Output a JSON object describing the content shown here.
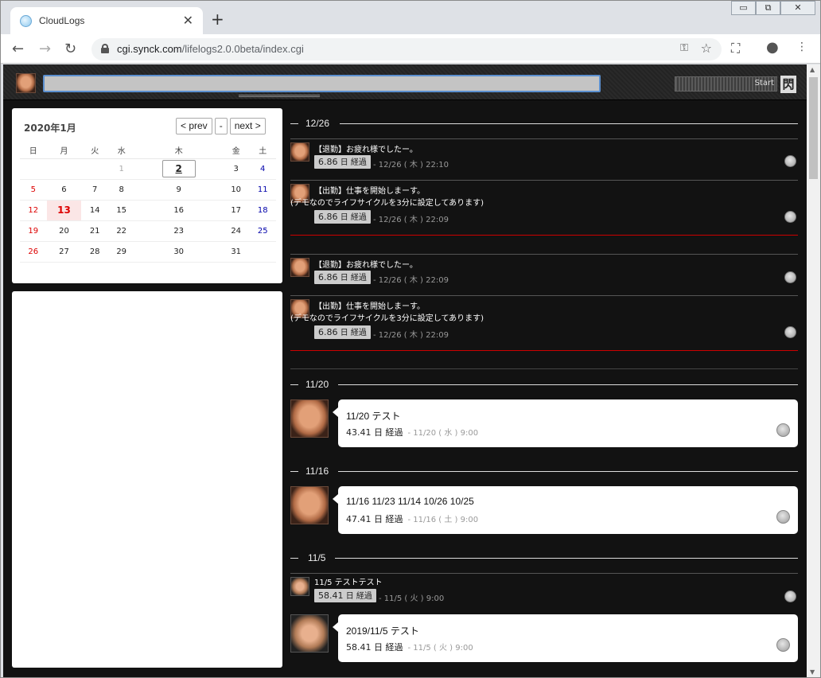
{
  "browser": {
    "tab_title": "CloudLogs",
    "tab_close": "✕",
    "new_tab": "+",
    "url_host": "cgi.synck.com",
    "url_path": "/lifelogs2.0.0beta/index.cgi",
    "window_buttons": [
      "▭",
      "⧉",
      "✕"
    ]
  },
  "header": {
    "post_placeholder": "",
    "start_label": "Start",
    "logo_char": "閃"
  },
  "calendar": {
    "title": "2020年1月",
    "prev_label": "< prev",
    "today_label": "-",
    "next_label": "next >",
    "weekdays": [
      "日",
      "月",
      "火",
      "水",
      "木",
      "金",
      "土"
    ],
    "weeks": [
      [
        "",
        "",
        "",
        "1",
        "2",
        "3",
        "4"
      ],
      [
        "5",
        "6",
        "7",
        "8",
        "9",
        "10",
        "11"
      ],
      [
        "12",
        "13",
        "14",
        "15",
        "16",
        "17",
        "18"
      ],
      [
        "19",
        "20",
        "21",
        "22",
        "23",
        "24",
        "25"
      ],
      [
        "26",
        "27",
        "28",
        "29",
        "30",
        "31",
        ""
      ]
    ]
  },
  "timeline": {
    "dates": [
      "12/26",
      "11/20",
      "11/16",
      "11/5"
    ],
    "entries": [
      {
        "text1": "【退勤】お疲れ様でしたー。",
        "text2": "",
        "days": "6.86",
        "unit": "日 経過",
        "ts": "- 12/26 ( 木 ) 22:10"
      },
      {
        "text1": "【出勤】仕事を開始しまーす。",
        "text2": "(デモなのでライフサイクルを3分に設定してあります)",
        "days": "6.86",
        "unit": "日 経過",
        "ts": "- 12/26 ( 木 ) 22:09"
      },
      {
        "text1": "【退勤】お疲れ様でしたー。",
        "text2": "",
        "days": "6.86",
        "unit": "日 経過",
        "ts": "- 12/26 ( 木 ) 22:09"
      },
      {
        "text1": "【出勤】仕事を開始しまーす。",
        "text2": "(デモなのでライフサイクルを3分に設定してあります)",
        "days": "6.86",
        "unit": "日 経過",
        "ts": "- 12/26 ( 木 ) 22:09"
      },
      {
        "text1": "11/5 テストテスト",
        "text2": "",
        "days": "58.41",
        "unit": "日 経過",
        "ts": "- 11/5 ( 火 ) 9:00"
      }
    ],
    "cards": [
      {
        "title": "11/20 テスト",
        "days": "43.41",
        "unit": "日 経過",
        "ts": "- 11/20 ( 水 ) 9:00"
      },
      {
        "title": "11/16 11/23 11/14 10/26 10/25",
        "days": "47.41",
        "unit": "日 経過",
        "ts": "- 11/16 ( 土 ) 9:00"
      },
      {
        "title": "2019/11/5 テスト",
        "days": "58.41",
        "unit": "日 経過",
        "ts": "- 11/5 ( 火 ) 9:00"
      }
    ]
  }
}
